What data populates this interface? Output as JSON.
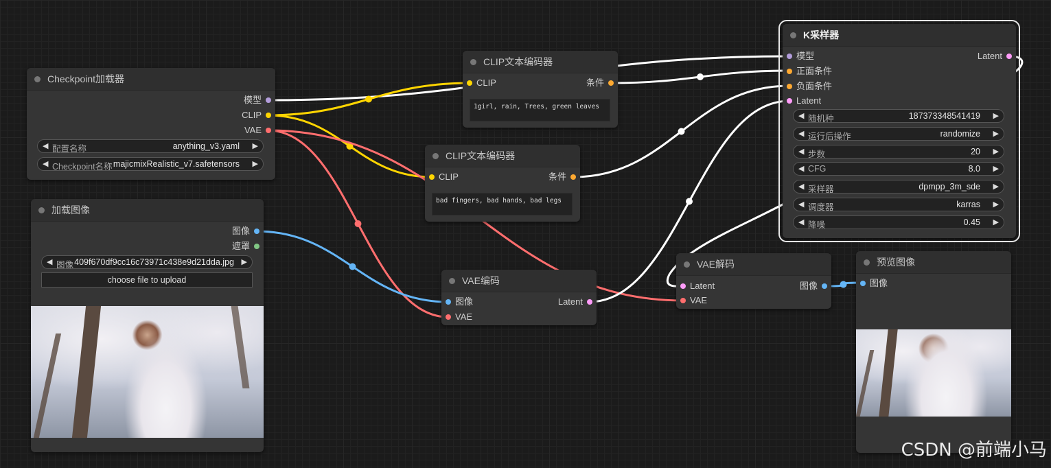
{
  "colors": {
    "model": "#b39ddb",
    "clip": "#ffd500",
    "vae": "#ff6e6e",
    "conditioning": "#ffa931",
    "latent": "#ff9cf9",
    "image": "#64b5f6",
    "mask": "#81c784",
    "wire_white": "#ffffff"
  },
  "checkpoint_loader": {
    "title": "Checkpoint加载器",
    "outputs": [
      "模型",
      "CLIP",
      "VAE"
    ],
    "config_label": "配置名称",
    "config_value": "anything_v3.yaml",
    "ckpt_label": "Checkpoint名称",
    "ckpt_value": "majicmixRealistic_v7.safetensors"
  },
  "load_image": {
    "title": "加载图像",
    "outputs": [
      "图像",
      "遮罩"
    ],
    "image_label": "图像",
    "image_value": "409f670df9cc16c73971c438e9d21dda.jpg",
    "upload_label": "choose file to upload"
  },
  "clip_encode_pos": {
    "title": "CLIP文本编码器",
    "input": "CLIP",
    "output": "条件",
    "text": "1girl, rain, Trees,  green leaves"
  },
  "clip_encode_neg": {
    "title": "CLIP文本编码器",
    "input": "CLIP",
    "output": "条件",
    "text": "bad fingers, bad hands, bad legs"
  },
  "vae_encode": {
    "title": "VAE编码",
    "inputs": [
      "图像",
      "VAE"
    ],
    "output": "Latent"
  },
  "ksampler": {
    "title": "K采样器",
    "inputs": [
      "模型",
      "正面条件",
      "负面条件",
      "Latent"
    ],
    "output": "Latent",
    "widgets": [
      {
        "label": "随机种",
        "value": "187373348541419"
      },
      {
        "label": "运行后操作",
        "value": "randomize"
      },
      {
        "label": "步数",
        "value": "20"
      },
      {
        "label": "CFG",
        "value": "8.0"
      },
      {
        "label": "采样器",
        "value": "dpmpp_3m_sde"
      },
      {
        "label": "调度器",
        "value": "karras"
      },
      {
        "label": "降噪",
        "value": "0.45"
      }
    ]
  },
  "vae_decode": {
    "title": "VAE解码",
    "inputs": [
      "Latent",
      "VAE"
    ],
    "output": "图像"
  },
  "preview_image": {
    "title": "预览图像",
    "input": "图像"
  },
  "watermark": "CSDN @前端小马"
}
